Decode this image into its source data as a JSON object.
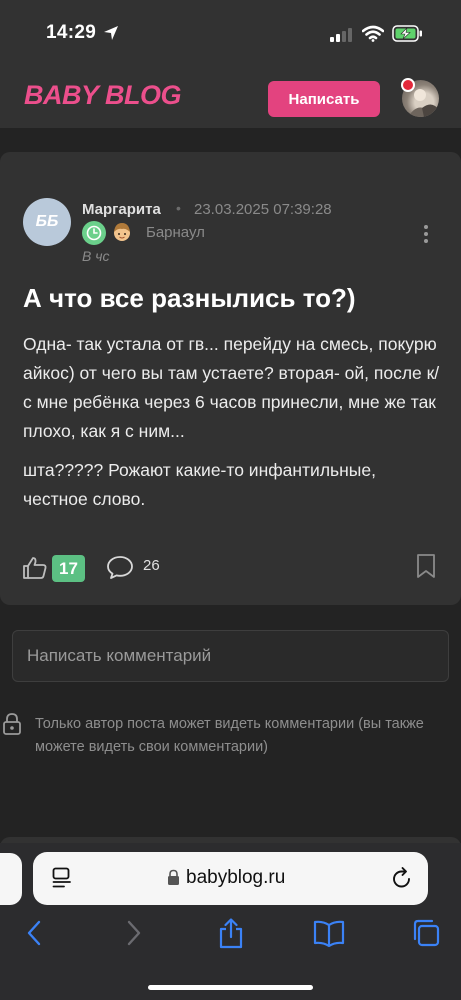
{
  "status_bar": {
    "time": "14:29",
    "icons": [
      "location-arrow-icon",
      "signal-icon",
      "wifi-icon",
      "battery-charging-icon"
    ]
  },
  "header": {
    "logo": "BABY BLOG",
    "write_button": "Написать",
    "brand_color": "#e3437f"
  },
  "post": {
    "author": {
      "avatar_initials": "ББ",
      "name": "Маргарита",
      "separator": "•",
      "date": "23.03.2025 07:39:28",
      "city": "Барнаул",
      "time_ago": "В чс"
    },
    "title": "А что все разнылись то?)",
    "paragraphs": [
      "Одна- так устала от гв... перейду на смесь, покурю айкос) от чего вы там устаете? вторая- ой, после к/с мне ребёнка через 6 часов принесли, мне же так плохо, как я с ним...",
      "шта????? Рожают какие-то инфантильные, честное слово."
    ],
    "likes": "17",
    "comments": "26"
  },
  "comments": {
    "placeholder": "Написать комментарий",
    "privacy_note": "Только автор поста может видеть комментарии (вы также можете видеть свои комментарии)"
  },
  "browser": {
    "url": "babyblog.ru"
  },
  "colors": {
    "background": "#232323",
    "card": "#323232",
    "accent": "#e3437f",
    "like_badge": "#5cc083",
    "toolbar_icons": "#3b82f6"
  }
}
